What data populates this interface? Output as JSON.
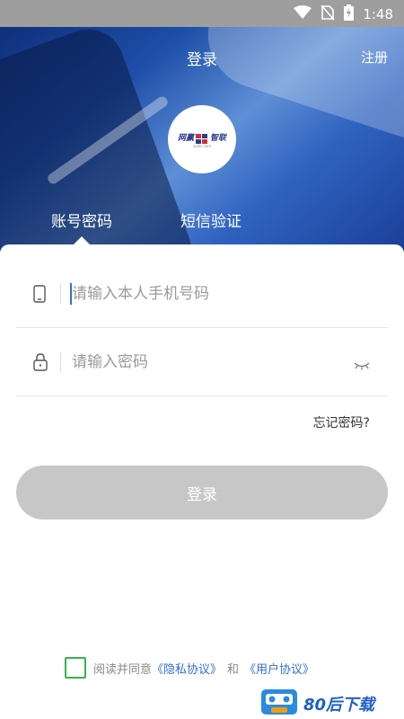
{
  "status_bar": {
    "time": "1:48"
  },
  "header": {
    "title": "登录",
    "register_label": "注册"
  },
  "logo": {
    "word_left": "网赢",
    "word_right": "智联",
    "sub": "vyaic.com"
  },
  "tabs": [
    {
      "label": "账号密码",
      "active": true
    },
    {
      "label": "短信验证",
      "active": false
    }
  ],
  "form": {
    "phone": {
      "placeholder": "请输入本人手机号码",
      "value": ""
    },
    "password": {
      "placeholder": "请输入密码",
      "value": ""
    }
  },
  "forgot_label": "忘记密码?",
  "login_button": "登录",
  "agreement": {
    "prefix": "阅读并同意",
    "privacy": "《隐私协议》",
    "and": "和",
    "user": "《用户协议》",
    "checked": false
  },
  "watermark": {
    "text": "80后下载"
  },
  "colors": {
    "accent": "#2f6fd6",
    "checkbox": "#33b54a",
    "button_disabled": "#c7c7c7"
  }
}
